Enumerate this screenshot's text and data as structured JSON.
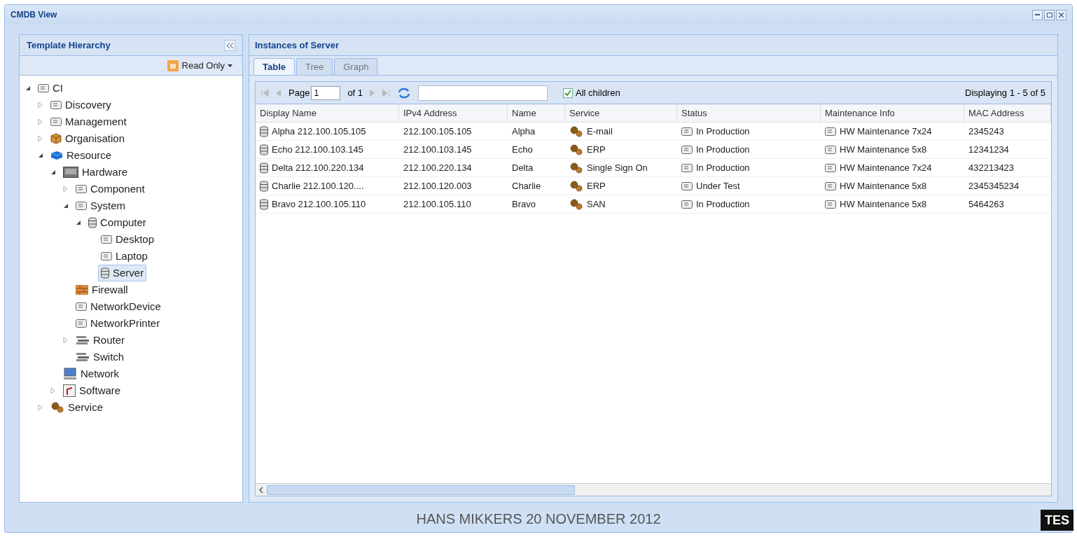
{
  "window": {
    "title": "CMDB View"
  },
  "hierarchy": {
    "title": "Template Hierarchy",
    "mode_button": "Read Only",
    "tree": [
      {
        "label": "CI",
        "kind": "card",
        "expanded": true,
        "selected": false,
        "children": [
          {
            "label": "Discovery",
            "kind": "card",
            "expanded": false,
            "selected": false
          },
          {
            "label": "Management",
            "kind": "card",
            "expanded": false,
            "selected": false
          },
          {
            "label": "Organisation",
            "kind": "box",
            "expanded": false,
            "selected": false
          },
          {
            "label": "Resource",
            "kind": "cube",
            "expanded": true,
            "selected": false,
            "children": [
              {
                "label": "Hardware",
                "kind": "hardware",
                "expanded": true,
                "selected": false,
                "children": [
                  {
                    "label": "Component",
                    "kind": "card",
                    "expanded": false,
                    "selected": false
                  },
                  {
                    "label": "System",
                    "kind": "card",
                    "expanded": true,
                    "selected": false,
                    "children": [
                      {
                        "label": "Computer",
                        "kind": "server",
                        "expanded": true,
                        "selected": false,
                        "children": [
                          {
                            "label": "Desktop",
                            "kind": "card",
                            "selected": false
                          },
                          {
                            "label": "Laptop",
                            "kind": "card",
                            "selected": false
                          },
                          {
                            "label": "Server",
                            "kind": "server",
                            "selected": true
                          }
                        ]
                      }
                    ]
                  },
                  {
                    "label": "Firewall",
                    "kind": "firewall",
                    "selected": false
                  },
                  {
                    "label": "NetworkDevice",
                    "kind": "card",
                    "selected": false
                  },
                  {
                    "label": "NetworkPrinter",
                    "kind": "card",
                    "selected": false
                  },
                  {
                    "label": "Router",
                    "kind": "router",
                    "expanded": false,
                    "selected": false
                  },
                  {
                    "label": "Switch",
                    "kind": "router",
                    "selected": false
                  }
                ]
              },
              {
                "label": "Network",
                "kind": "network",
                "selected": false
              },
              {
                "label": "Software",
                "kind": "software",
                "expanded": false,
                "selected": false
              }
            ]
          },
          {
            "label": "Service",
            "kind": "gears",
            "expanded": false,
            "selected": false
          }
        ]
      }
    ]
  },
  "instances": {
    "title": "Instances of Server",
    "tabs": [
      {
        "label": "Table",
        "selected": true
      },
      {
        "label": "Tree",
        "selected": false
      },
      {
        "label": "Graph",
        "selected": false
      }
    ],
    "pager": {
      "page_label": "Page",
      "page": "1",
      "of": "of 1",
      "all_children": {
        "label": "All children",
        "checked": true
      },
      "displaying": "Displaying 1 - 5 of 5"
    },
    "columns": [
      "Display Name",
      "IPv4 Address",
      "Name",
      "Service",
      "Status",
      "Maintenance Info",
      "MAC Address"
    ],
    "rows": [
      {
        "display_name": "Alpha 212.100.105.105",
        "ipv4": "212.100.105.105",
        "name": "Alpha",
        "service": "E-mail",
        "status": "In Production",
        "maintenance": "HW Maintenance 7x24",
        "mac": "2345243"
      },
      {
        "display_name": "Echo 212.100.103.145",
        "ipv4": "212.100.103.145",
        "name": "Echo",
        "service": "ERP",
        "status": "In Production",
        "maintenance": "HW Maintenance 5x8",
        "mac": "12341234"
      },
      {
        "display_name": "Delta 212.100.220.134",
        "ipv4": "212.100.220.134",
        "name": "Delta",
        "service": "Single Sign On",
        "status": "In Production",
        "maintenance": "HW Maintenance 7x24",
        "mac": "432213423"
      },
      {
        "display_name": "Charlie 212.100.120....",
        "ipv4": "212.100.120.003",
        "name": "Charlie",
        "service": "ERP",
        "status": "Under Test",
        "maintenance": "HW Maintenance 5x8",
        "mac": "2345345234"
      },
      {
        "display_name": "Bravo 212.100.105.110",
        "ipv4": "212.100.105.110",
        "name": "Bravo",
        "service": "SAN",
        "status": "In Production",
        "maintenance": "HW Maintenance 5x8",
        "mac": "5464263"
      }
    ]
  },
  "slide_footer": {
    "text": "HANS MIKKERS 20 NOVEMBER 2012",
    "logo": "TES"
  }
}
